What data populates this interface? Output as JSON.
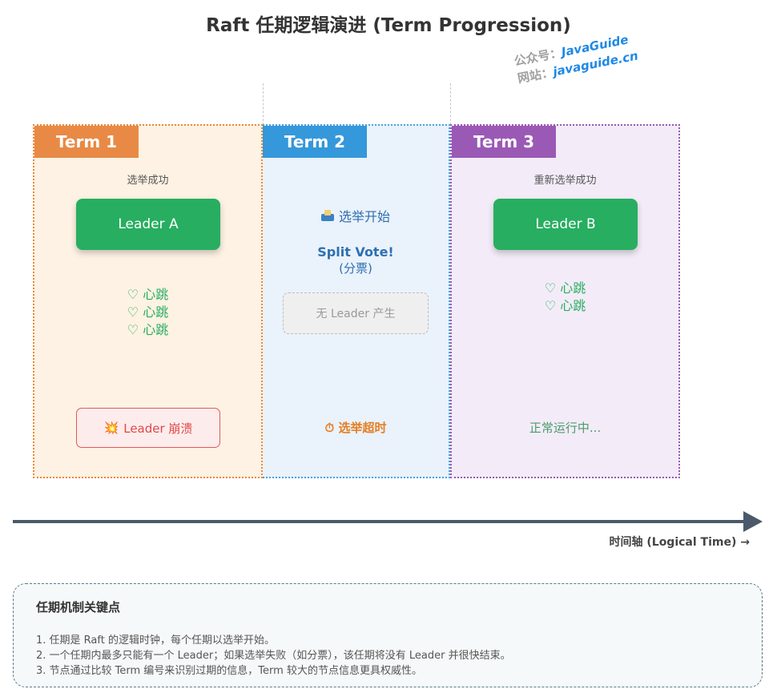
{
  "title": "Raft 任期逻辑演进 (Term Progression)",
  "watermark": {
    "line1_label": "公众号：",
    "line1_value": "JavaGuide",
    "line2_label": "网站：",
    "line2_value": "javaguide.cn"
  },
  "terms": [
    {
      "tab": "Term 1",
      "status": "选举成功",
      "leader": "Leader A",
      "heartbeats": [
        "♡ 心跳",
        "♡ 心跳",
        "♡ 心跳"
      ],
      "event": "Leader 崩溃",
      "event_icon": "💥"
    },
    {
      "tab": "Term 2",
      "election_start": "选举开始",
      "split_vote": "Split Vote!",
      "split_vote_sub": "(分票)",
      "no_leader": "无 Leader 产生",
      "event": "选举超时",
      "event_icon": "⏱"
    },
    {
      "tab": "Term 3",
      "status": "重新选举成功",
      "leader": "Leader B",
      "heartbeats": [
        "♡ 心跳",
        "♡ 心跳"
      ],
      "event": "正常运行中..."
    }
  ],
  "axis_label": "时间轴 (Logical Time) →",
  "notes": {
    "title": "任期机制关键点",
    "items": [
      "1. 任期是 Raft 的逻辑时钟，每个任期以选举开始。",
      "2. 一个任期内最多只能有一个 Leader；如果选举失败（如分票），该任期将没有 Leader 并很快结束。",
      "3. 节点通过比较 Term 编号来识别过期的信息，Term 较大的节点信息更具权威性。"
    ]
  },
  "colors": {
    "term1": "#e88a45",
    "term2": "#3498db",
    "term3": "#9b59b6",
    "leader": "#27ae60",
    "crash": "#e04848",
    "timeout": "#e67e22"
  }
}
